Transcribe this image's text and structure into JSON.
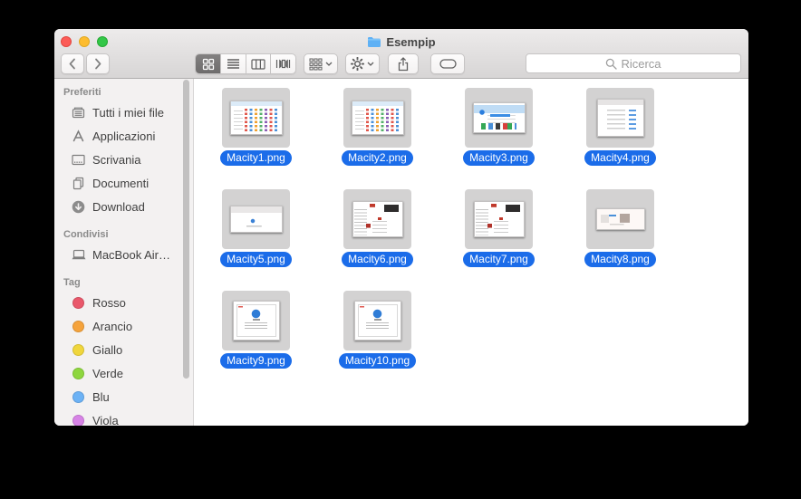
{
  "window": {
    "title": "Esempip"
  },
  "traffic_lights": {
    "close_color": "#fc5b57",
    "minimize_color": "#fdbc2e",
    "zoom_color": "#33c748"
  },
  "toolbar": {
    "view_segments": [
      {
        "name": "icon-view",
        "selected": true
      },
      {
        "name": "list-view",
        "selected": false
      },
      {
        "name": "column-view",
        "selected": false
      },
      {
        "name": "coverflow-view",
        "selected": false
      }
    ],
    "buttons": [
      "back",
      "forward",
      "arrange",
      "action",
      "share",
      "tags"
    ],
    "search": {
      "placeholder": "Ricerca",
      "value": ""
    }
  },
  "sidebar": {
    "sections": [
      {
        "title": "Preferiti",
        "items": [
          {
            "label": "Tutti i miei file",
            "icon": "all-my-files-icon"
          },
          {
            "label": "Applicazioni",
            "icon": "applications-icon"
          },
          {
            "label": "Scrivania",
            "icon": "desktop-icon"
          },
          {
            "label": "Documenti",
            "icon": "documents-icon"
          },
          {
            "label": "Download",
            "icon": "download-icon"
          }
        ]
      },
      {
        "title": "Condivisi",
        "items": [
          {
            "label": "MacBook Air…",
            "icon": "laptop-icon"
          }
        ]
      },
      {
        "title": "Tag",
        "items": [
          {
            "label": "Rosso",
            "color": "#e9586b"
          },
          {
            "label": "Arancio",
            "color": "#f5a33c"
          },
          {
            "label": "Giallo",
            "color": "#f0d63c"
          },
          {
            "label": "Verde",
            "color": "#8ed63f"
          },
          {
            "label": "Blu",
            "color": "#6cb2f5"
          },
          {
            "label": "Viola",
            "color": "#d783e6"
          }
        ]
      }
    ]
  },
  "files": [
    {
      "name": "Macity1.png",
      "kind": "icon-grid",
      "selected": true
    },
    {
      "name": "Macity2.png",
      "kind": "icon-grid",
      "selected": true
    },
    {
      "name": "Macity3.png",
      "kind": "promo-page",
      "selected": true
    },
    {
      "name": "Macity4.png",
      "kind": "settings-form",
      "selected": true
    },
    {
      "name": "Macity5.png",
      "kind": "doc-toolbar",
      "selected": true
    },
    {
      "name": "Macity6.png",
      "kind": "news-page",
      "selected": true
    },
    {
      "name": "Macity7.png",
      "kind": "news-page",
      "selected": true
    },
    {
      "name": "Macity8.png",
      "kind": "wide-banner",
      "selected": true
    },
    {
      "name": "Macity9.png",
      "kind": "info-dialog",
      "selected": true
    },
    {
      "name": "Macity10.png",
      "kind": "info-dialog",
      "selected": true
    }
  ],
  "colors": {
    "label_selected_bg": "#1b6ce9",
    "icon_selected_bg": "#d3d2d2",
    "sidebar_bg": "#f3f1f1"
  }
}
